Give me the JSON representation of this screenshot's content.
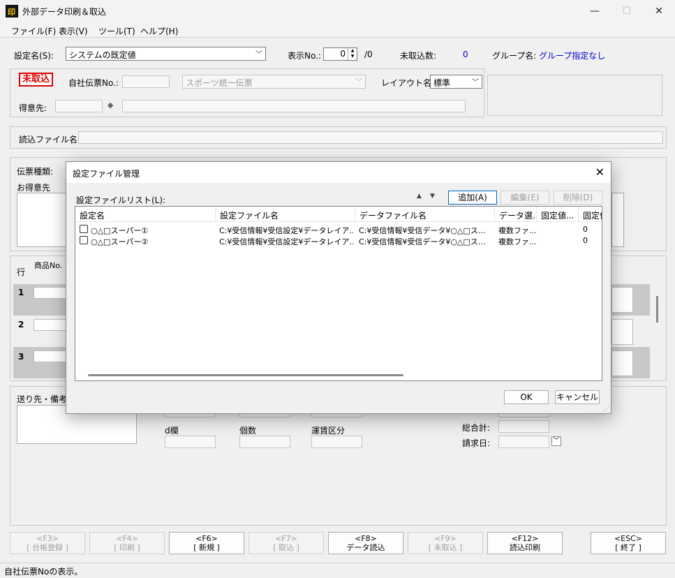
{
  "window": {
    "title": "外部データ印刷＆取込",
    "minimize": "—",
    "maximize": "☐",
    "close": "✕"
  },
  "menu": [
    "ファイル(F)",
    "表示(V)",
    "ツール(T)",
    "ヘルプ(H)"
  ],
  "settings_bar": {
    "setting_name_label": "設定名(S):",
    "setting_name_value": "システムの既定値",
    "display_no_label": "表示No.:",
    "display_no_value": "0",
    "display_no_total": "/0",
    "unimported_label": "未取込数:",
    "unimported_value": "0",
    "group_label": "グループ名:",
    "group_value": "グループ指定なし"
  },
  "header_panel": {
    "status_badge": "未取込",
    "slip_no_label": "自社伝票No.:",
    "slip_type_value": "スポーツ統一伝票",
    "layout_label": "レイアウト名:",
    "layout_value": "標準",
    "customer_label": "得意先:",
    "diamond": "◆"
  },
  "read_file_label": "読込ファイル名:",
  "background_form": {
    "slip_kind_label": "伝票種類:",
    "customer_label": "お得意先",
    "row_label": "行",
    "product_no_label": "商品No.",
    "rows": [
      "1",
      "2",
      "3"
    ],
    "memo_label": "送り先・備考",
    "d_col_label": "d欄",
    "count_label": "個数",
    "freight_label": "運賃区分",
    "total_label": "総合計:",
    "bill_date_label": "請求日:"
  },
  "fkeys": [
    {
      "key": "<F3>",
      "label": "[ 台帳登録 ]",
      "enabled": false
    },
    {
      "key": "<F4>",
      "label": "[ 印刷 ]",
      "enabled": false
    },
    {
      "key": "<F6>",
      "label": "[ 新規 ]",
      "enabled": true
    },
    {
      "key": "<F7>",
      "label": "[ 取込 ]",
      "enabled": false
    },
    {
      "key": "<F8>",
      "label": "データ読込",
      "enabled": true
    },
    {
      "key": "<F9>",
      "label": "[ 未取込 ]",
      "enabled": false
    },
    {
      "key": "<F12>",
      "label": "読込印刷",
      "enabled": true
    },
    {
      "key": "<ESC>",
      "label": "[ 終了 ]",
      "enabled": true
    }
  ],
  "status_text": "自社伝票Noの表示。",
  "dialog": {
    "title": "設定ファイル管理",
    "close": "✕",
    "list_label": "設定ファイルリスト(L):",
    "up_arrow": "▲",
    "down_arrow": "▼",
    "add_button": "追加(A)",
    "edit_button": "編集(E)",
    "delete_button": "削除(D)",
    "columns": [
      "設定名",
      "設定ファイル名",
      "データファイル名",
      "データ選...",
      "固定値...",
      "固定値"
    ],
    "rows": [
      {
        "name": "○△□スーパー①",
        "setting_file": "C:¥受信情報¥受信設定¥データレイア...",
        "data_file": "C:¥受信情報¥受信データ¥○△□ス...",
        "data_sel": "複数ファ...",
        "fixed1": "",
        "fixed2": "0"
      },
      {
        "name": "○△□スーパー②",
        "setting_file": "C:¥受信情報¥受信設定¥データレイア...",
        "data_file": "C:¥受信情報¥受信データ¥○△□ス...",
        "data_sel": "複数ファ...",
        "fixed1": "",
        "fixed2": "0"
      }
    ],
    "ok_button": "OK",
    "cancel_button": "キャンセル"
  }
}
